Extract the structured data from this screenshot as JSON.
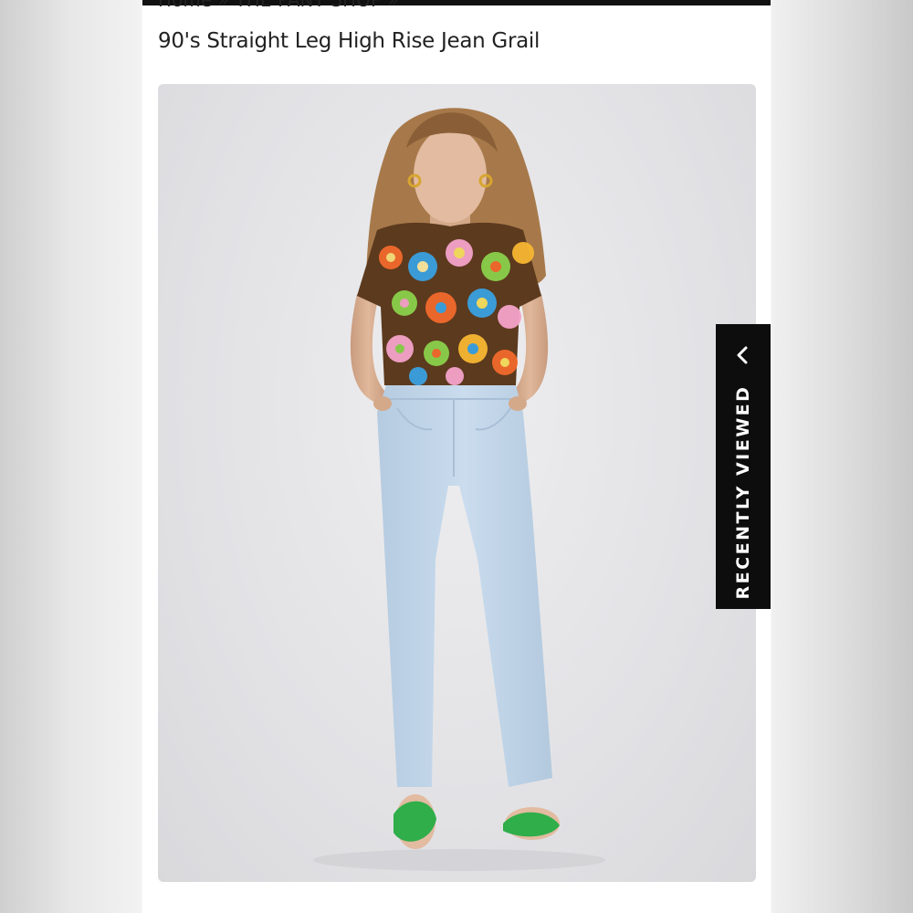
{
  "breadcrumb": {
    "text": "Home » THE PANT SHOP »"
  },
  "product": {
    "title": "90's Straight Leg High Rise Jean Grail"
  },
  "recently_viewed": {
    "label": "RECENTLY VIEWED",
    "icon": "chevron-left-icon"
  },
  "colors": {
    "tab_background": "#0d0d0d",
    "image_background": "#e4e4e7",
    "sandals": "#2fae4a",
    "jeans": "#c3d7ea"
  }
}
